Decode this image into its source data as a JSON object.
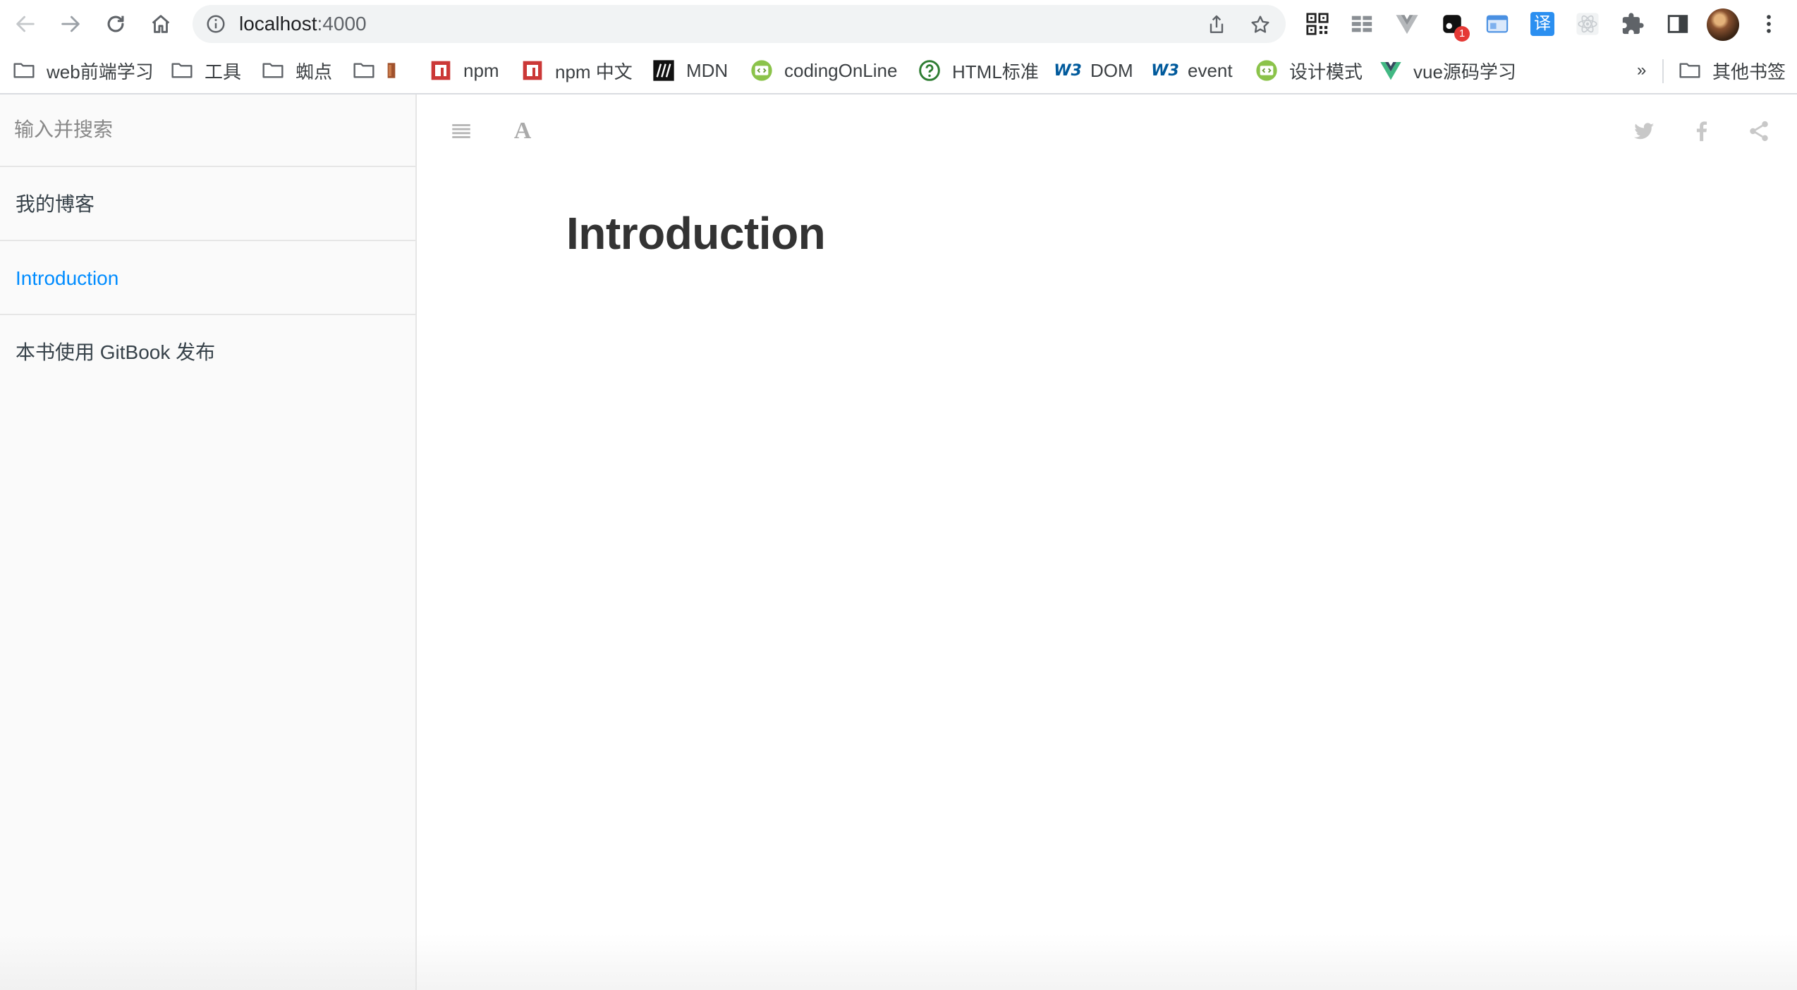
{
  "browser": {
    "url_host": "localhost",
    "url_port": ":4000",
    "icons": {
      "back": "arrow-left-icon",
      "forward": "arrow-right-icon",
      "reload": "reload-icon",
      "home": "home-icon",
      "site_info": "info-icon",
      "share": "share-icon",
      "bookmark": "star-icon"
    },
    "extensions": [
      {
        "name": "qr-code-extension-icon"
      },
      {
        "name": "grid-extension-icon"
      },
      {
        "name": "vue-devtools-extension-icon"
      },
      {
        "name": "notification-extension-icon",
        "badge": "1"
      },
      {
        "name": "window-extension-icon"
      },
      {
        "name": "translate-extension-icon",
        "glyph": "译"
      },
      {
        "name": "react-extension-icon"
      },
      {
        "name": "puzzle-extensions-icon"
      },
      {
        "name": "side-panel-icon"
      }
    ],
    "menu_icon": "more-vert-icon"
  },
  "bookmarks": {
    "items": [
      {
        "label": "web前端学习",
        "icon": "folder-icon"
      },
      {
        "label": "工具",
        "icon": "folder-icon"
      },
      {
        "label": "蜘点",
        "icon": "folder-icon"
      },
      {
        "label": "",
        "icon": "folder-icon"
      },
      {
        "label": "npm",
        "icon": "npm-icon"
      },
      {
        "label": "npm 中文",
        "icon": "npm-icon"
      },
      {
        "label": "MDN",
        "icon": "mdn-icon"
      },
      {
        "label": "codingOnLine",
        "icon": "code-icon"
      },
      {
        "label": "HTML标准",
        "icon": "question-circle-icon"
      },
      {
        "label": "DOM",
        "icon": "w3-icon"
      },
      {
        "label": "event",
        "icon": "w3-icon"
      },
      {
        "label": "设计模式",
        "icon": "code-icon"
      },
      {
        "label": "vue源码学习",
        "icon": "vue-icon"
      }
    ],
    "overflow": "»",
    "other": {
      "label": "其他书签",
      "icon": "folder-icon"
    }
  },
  "sidebar": {
    "search_placeholder": "输入并搜索",
    "items": [
      {
        "label": "我的博客",
        "active": false
      },
      {
        "label": "Introduction",
        "active": true
      },
      {
        "label": "本书使用 GitBook 发布",
        "active": false
      }
    ]
  },
  "toolbar": {
    "font_label": "A",
    "icons": [
      "menu-icon",
      "font-settings-icon",
      "twitter-icon",
      "facebook-icon",
      "share-icon"
    ]
  },
  "content": {
    "title": "Introduction"
  },
  "colors": {
    "active_link": "#008cff",
    "sidebar_bg": "#fafafa",
    "npm_red": "#cb3837",
    "vue_green": "#41b883",
    "w3_blue": "#005a9c"
  }
}
